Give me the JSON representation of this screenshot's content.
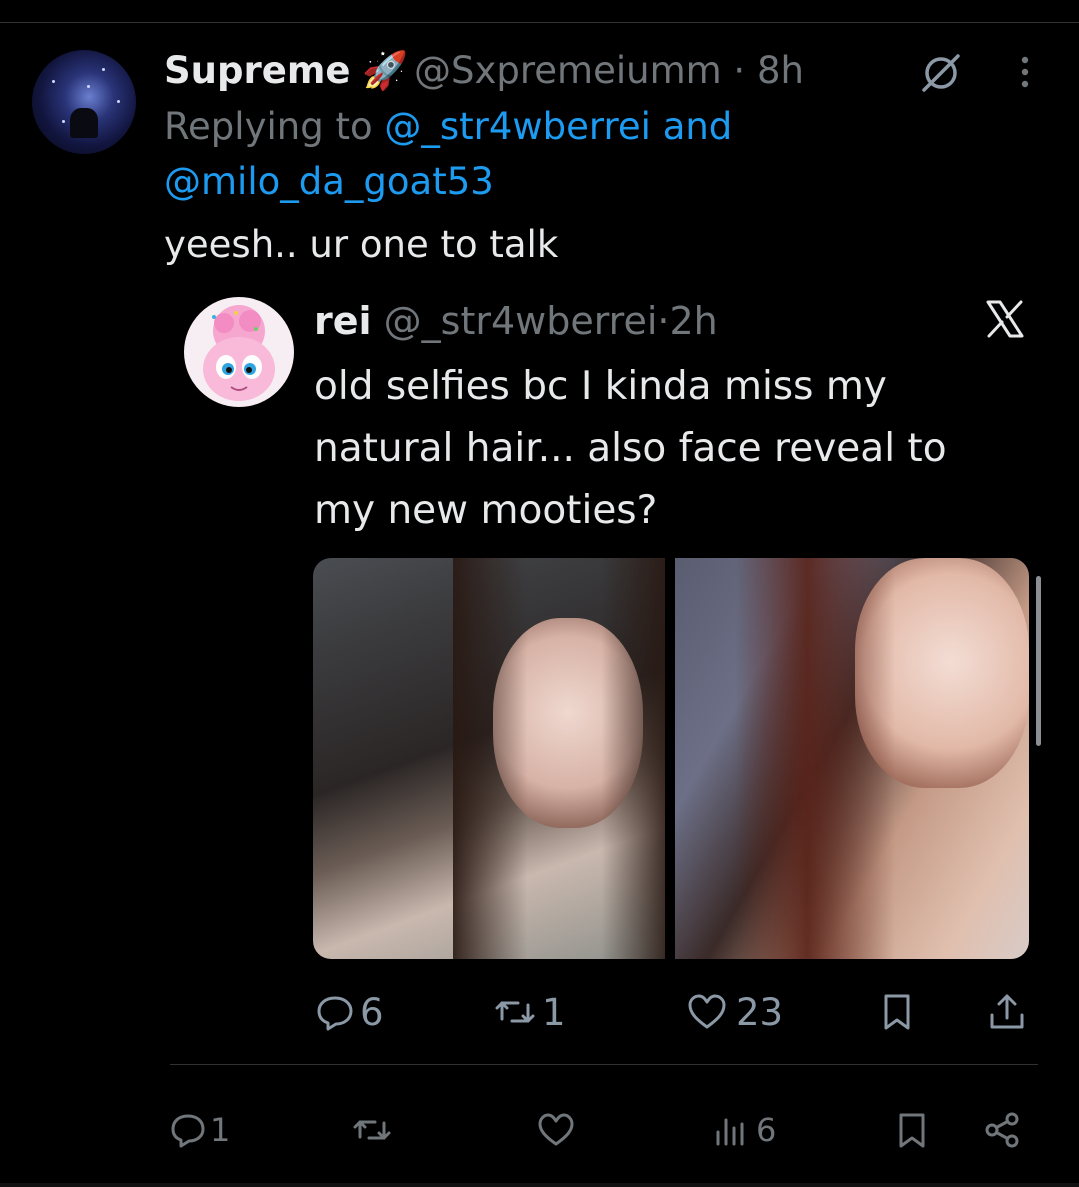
{
  "reply": {
    "author_name": "Supreme",
    "author_emoji": "🚀",
    "handle": "@Sxpremeiumm",
    "separator": "·",
    "time": "8h",
    "replying_prefix": "Replying to",
    "replying_to_1": "@_str4wberrei and",
    "replying_to_2": "@milo_da_goat53",
    "text": "yeesh.. ur one to talk"
  },
  "quoted": {
    "author_name": "rei",
    "handle": "@_str4wberrei",
    "separator": "·",
    "time": "2h",
    "text": "old selfies bc I kinda miss my natural hair... also face reveal to my new mooties?",
    "images": [
      "selfie-photo-1",
      "selfie-photo-2"
    ],
    "actions": {
      "replies": "6",
      "reposts": "1",
      "likes": "23"
    }
  },
  "actions": {
    "replies": "1",
    "views": "6"
  },
  "colors": {
    "background": "#000000",
    "text": "#e7e9ea",
    "muted": "#71767b",
    "link": "#1d9bf0",
    "divider": "#2f3336"
  },
  "icons": [
    "rocket-emoji",
    "grok-icon",
    "more-icon",
    "x-logo-icon",
    "reply-icon",
    "repost-icon",
    "like-icon",
    "bookmark-icon",
    "share-icon",
    "views-icon"
  ]
}
